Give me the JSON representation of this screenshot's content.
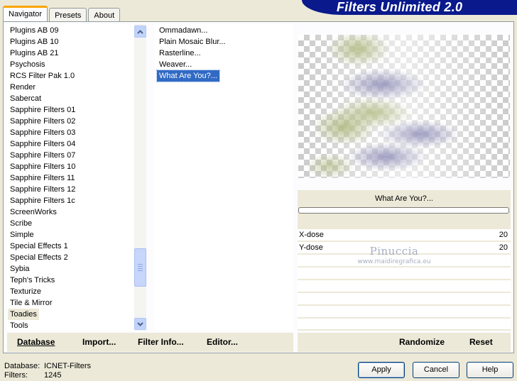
{
  "tabs": [
    {
      "label": "Navigator",
      "active": true
    },
    {
      "label": "Presets",
      "active": false
    },
    {
      "label": "About",
      "active": false
    }
  ],
  "title": "Filters Unlimited 2.0",
  "categories": [
    "Plugins AB 09",
    "Plugins AB 10",
    "Plugins AB 21",
    "Psychosis",
    "RCS Filter Pak 1.0",
    "Render",
    "Sabercat",
    "Sapphire Filters 01",
    "Sapphire Filters 02",
    "Sapphire Filters 03",
    "Sapphire Filters 04",
    "Sapphire Filters 07",
    "Sapphire Filters 10",
    "Sapphire Filters 11",
    "Sapphire Filters 12",
    "Sapphire Filters 1c",
    "ScreenWorks",
    "Scribe",
    "Simple",
    "Special Effects 1",
    "Special Effects 2",
    "Sybia",
    "Teph's Tricks",
    "Texturize",
    "Tile & Mirror",
    "Toadies",
    "Tools"
  ],
  "selected_category": "Toadies",
  "filters": [
    "Ommadawn...",
    "Plain Mosaic Blur...",
    "Rasterline...",
    "Weaver...",
    "What Are You?..."
  ],
  "selected_filter": "What Are You?...",
  "scroll_position": 0.82,
  "current_filter_title": "What Are You?...",
  "params": [
    {
      "label": "X-dose",
      "value": "20"
    },
    {
      "label": "Y-dose",
      "value": "20"
    }
  ],
  "watermark": {
    "line1": "Pinuccia",
    "line2": "www.maidiregrafica.eu"
  },
  "left_bar_buttons": {
    "database": "Database",
    "import": "Import...",
    "filter_info": "Filter Info...",
    "editor": "Editor..."
  },
  "right_bar_buttons": {
    "randomize": "Randomize",
    "reset": "Reset"
  },
  "status": {
    "database_label": "Database:",
    "database_value": "ICNET-Filters",
    "filters_label": "Filters:",
    "filters_value": "1245"
  },
  "dialog_buttons": {
    "apply": "Apply",
    "cancel": "Cancel",
    "help": "Help"
  },
  "colors": {
    "title_banner": "#0a1a8c",
    "selection": "#316ac5",
    "window": "#ece9d8",
    "active_tab_accent": "#f9a500"
  },
  "icons": {
    "scroll_up": "triangle-up-icon",
    "scroll_down": "triangle-down-icon",
    "scroll_thumb_grip": "grip-icon"
  }
}
